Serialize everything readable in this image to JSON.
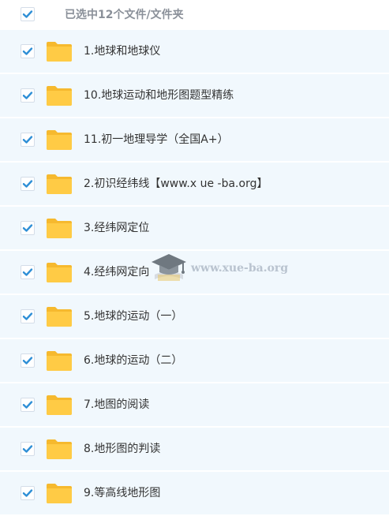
{
  "header": {
    "label": "已选中12个文件/文件夹"
  },
  "items": [
    {
      "label": "1.地球和地球仪"
    },
    {
      "label": "10.地球运动和地形图题型精练"
    },
    {
      "label": "11.初一地理导学（全国A+）"
    },
    {
      "label": "2.初识经纬线【www.x ue -ba.org】"
    },
    {
      "label": "3.经纬网定位"
    },
    {
      "label": "4.经纬网定向"
    },
    {
      "label": "5.地球的运动（一）"
    },
    {
      "label": "6.地球的运动（二）"
    },
    {
      "label": "7.地图的阅读"
    },
    {
      "label": "8.地形图的判读"
    },
    {
      "label": "9.等高线地形图"
    }
  ],
  "watermark": {
    "text": "www.xue-ba.org"
  },
  "colors": {
    "check": "#2f8fd6",
    "folder": "#ffcb45",
    "row_bg": "#f1f8fd"
  },
  "icons": {
    "checkbox": "checkmark-icon",
    "folder": "folder-icon",
    "watermark": "graduation-cap-icon"
  }
}
